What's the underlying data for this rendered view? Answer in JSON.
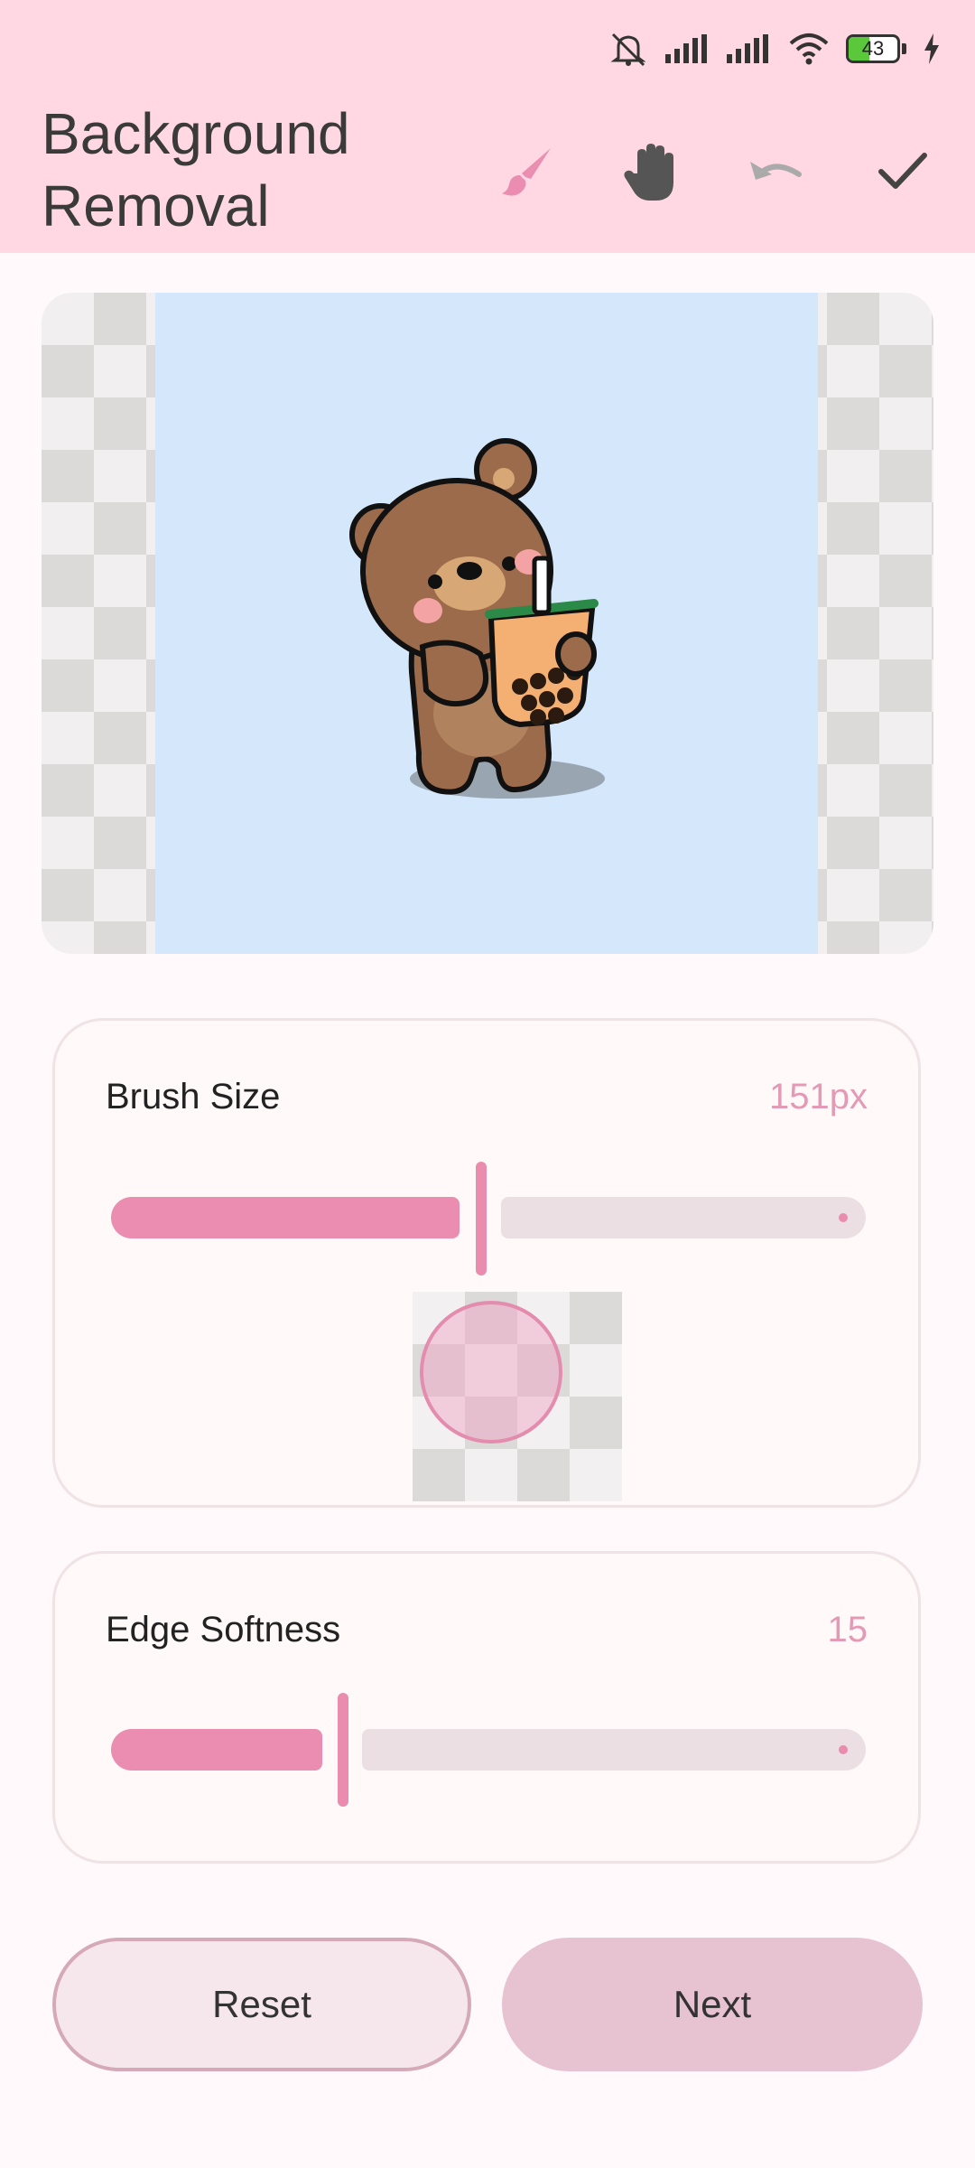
{
  "status_bar": {
    "battery_level": "43",
    "icons": [
      "mute-icon",
      "signal-icon",
      "signal-icon",
      "wifi-icon",
      "battery-icon",
      "charging-icon"
    ]
  },
  "header": {
    "title": "Background Removal",
    "tools": [
      "brush-icon",
      "hand-icon",
      "undo-icon",
      "check-icon"
    ]
  },
  "brush_size": {
    "label": "Brush Size",
    "value": "151px",
    "level": 0.5
  },
  "edge_softness": {
    "label": "Edge Softness",
    "value": "15",
    "level": 0.3
  },
  "actions": {
    "reset_label": "Reset",
    "next_label": "Next"
  },
  "colors": {
    "accent": "#ea8db0",
    "header_bg": "#ffd8e3",
    "preview_bg": "#d5e8fb"
  }
}
